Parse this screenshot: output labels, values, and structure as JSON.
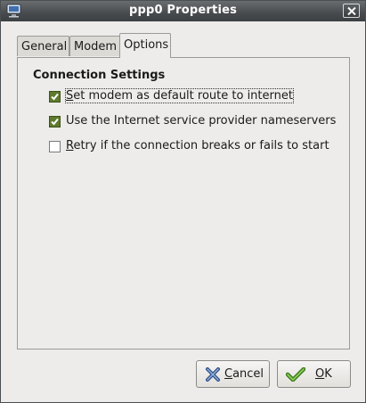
{
  "window": {
    "title": "ppp0 Properties",
    "icons": {
      "app": "network-computer-icon",
      "close": "close-icon"
    }
  },
  "tabs": [
    {
      "label": "General",
      "active": false
    },
    {
      "label": "Modem",
      "active": false
    },
    {
      "label": "Options",
      "active": true
    }
  ],
  "options": {
    "section_title": "Connection Settings",
    "checkboxes": [
      {
        "mnemonic": "S",
        "rest": "et modem as default route to internet",
        "checked": true,
        "focused": true
      },
      {
        "mnemonic": "",
        "rest": "Use the Internet service provider nameservers",
        "checked": true,
        "focused": false
      },
      {
        "mnemonic": "R",
        "rest": "etry if the connection breaks or fails to start",
        "checked": false,
        "focused": false
      }
    ]
  },
  "buttons": {
    "cancel": {
      "mnemonic": "C",
      "rest": "ancel",
      "icon": "cancel-x-icon"
    },
    "ok": {
      "mnemonic": "O",
      "rest": "K",
      "icon": "ok-checkmark-icon"
    }
  },
  "colors": {
    "check_fill": "#5f7a2e",
    "titlebar": "#474b4e"
  }
}
